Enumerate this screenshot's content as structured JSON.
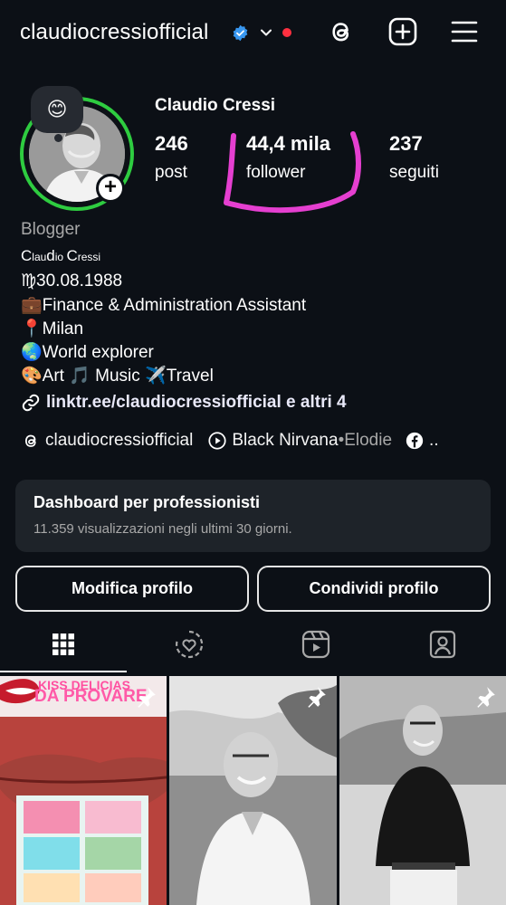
{
  "header": {
    "username": "claudiocressiofficial",
    "verified": true,
    "notification_dot_color": "#ff3040",
    "icons": [
      "threads-icon",
      "new-post-icon",
      "menu-icon"
    ]
  },
  "profile": {
    "note_emoji": "😊",
    "display_name": "Claudio Cressi",
    "stats": [
      {
        "value": "246",
        "label": "post"
      },
      {
        "value": "44,4 mila",
        "label": "follower"
      },
      {
        "value": "237",
        "label": "seguiti"
      }
    ],
    "category": "Blogger",
    "bio_name_parts": [
      "C",
      "lau",
      "d",
      "io ",
      "C",
      "ressi"
    ],
    "bio_lines": [
      "♍30.08.1988",
      "💼Finance & Administration Assistant",
      "📍Milan",
      "🌏World explorer",
      "🎨Art 🎵 Music ✈️Travel"
    ],
    "link_text": "linktr.ee/claudiocressiofficial e altri 4",
    "threads_handle": "claudiocressiofficial",
    "music_artist": "Black Nirvana",
    "music_separator": " • ",
    "music_artist2": "Elodie",
    "facebook_suffix": ".."
  },
  "dashboard": {
    "title": "Dashboard per professionisti",
    "subtitle": "11.359 visualizzazioni negli ultimi 30 giorni."
  },
  "buttons": {
    "edit_profile": "Modifica profilo",
    "share_profile": "Condividi profilo"
  },
  "tabs": [
    "grid-tab",
    "reels-remix-tab",
    "reels-tab",
    "tagged-tab"
  ],
  "grid": {
    "post1_caption_line1": "KISS DELICIAS",
    "post1_caption_line2": "DA PROVARE",
    "pinned": [
      true,
      true,
      true
    ]
  },
  "colors": {
    "background": "#0c1016",
    "story_ring": "#2ecc40",
    "highlight_marker": "#e53fd0",
    "verified_badge": "#3897f0"
  }
}
